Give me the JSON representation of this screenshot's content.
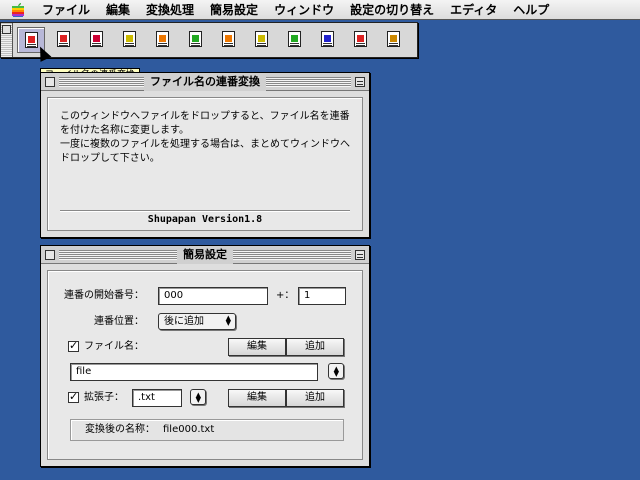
{
  "menubar": {
    "items": [
      "ファイル",
      "編集",
      "変換処理",
      "簡易設定",
      "ウィンドウ",
      "設定の切り替え",
      "エディタ",
      "ヘルプ"
    ]
  },
  "toolbar": {
    "tooltip": "ファイル名の連番変換",
    "tools": [
      {
        "icon": "rename-sequential-icon",
        "color": "#d22"
      },
      {
        "icon": "document-copy-icon",
        "color": "#d22"
      },
      {
        "icon": "document-red-icon",
        "color": "#c03"
      },
      {
        "icon": "document-yellow-icon",
        "color": "#cb0"
      },
      {
        "icon": "document-edit-icon",
        "color": "#e70"
      },
      {
        "icon": "document-number-icon",
        "color": "#2a2"
      },
      {
        "icon": "document-list-icon",
        "color": "#e70"
      },
      {
        "icon": "document-arrow-icon",
        "color": "#cb0"
      },
      {
        "icon": "document-check-icon",
        "color": "#2a2"
      },
      {
        "icon": "document-blue-icon",
        "color": "#22c"
      },
      {
        "icon": "document-red-check-icon",
        "color": "#d22"
      },
      {
        "icon": "document-stack-icon",
        "color": "#c80"
      }
    ]
  },
  "window_rename": {
    "title": "ファイル名の連番変換",
    "description": [
      "このウィンドウへファイルをドロップすると、ファイル名を連番",
      "を付けた名称に変更します。",
      "一度に複数のファイルを処理する場合は、まとめてウィンドウへ",
      "ドロップして下さい。"
    ],
    "version": "Shupapan Version1.8"
  },
  "window_settings": {
    "title": "簡易設定",
    "start_number_label": "連番の開始番号：",
    "start_number_value": "000",
    "increment_label": "+：",
    "increment_value": "1",
    "position_label": "連番位置：",
    "position_value": "後に追加",
    "filename_label": "ファイル名：",
    "filename_checked": true,
    "filename_value": "file",
    "extension_label": "拡張子：",
    "extension_checked": true,
    "extension_value": ".txt",
    "edit_button": "編集",
    "add_button": "追加",
    "result_label": "変換後の名称：",
    "result_value": "file000.txt"
  }
}
